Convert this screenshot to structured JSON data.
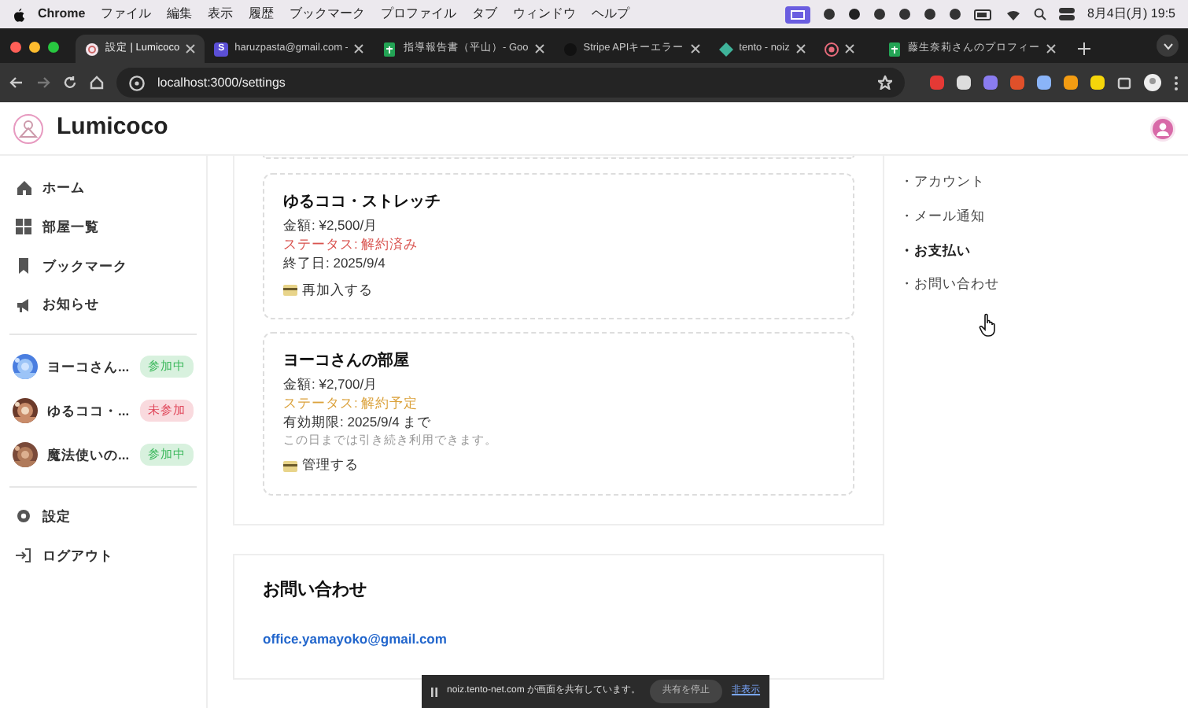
{
  "menu_bar": {
    "app": "Chrome",
    "menus": [
      "ファイル",
      "編集",
      "表示",
      "履歴",
      "ブックマーク",
      "プロファイル",
      "タブ",
      "ウィンドウ",
      "ヘルプ"
    ],
    "clock": "8月4日(月) 19:5"
  },
  "browser": {
    "tabs": [
      {
        "title": "設定 | Lumicoco",
        "selected": true,
        "kind": "logo"
      },
      {
        "title": "haruzpasta@gmail.com -",
        "selected": false,
        "kind": "letter",
        "icon_text": "S"
      },
      {
        "title": "指導報告書（平山）- Goo",
        "selected": false,
        "kind": "sheet"
      },
      {
        "title": "Stripe APIキーエラー",
        "selected": false,
        "kind": "dark"
      },
      {
        "title": "tento - noiz",
        "selected": false,
        "kind": "diamond"
      },
      {
        "selected": false,
        "kind": "target"
      },
      {
        "title": "藤生奈莉さんのプロフィー",
        "selected": false,
        "kind": "sheet"
      }
    ],
    "url": "localhost:3000/settings"
  },
  "app": {
    "brand": "Lumicoco",
    "sidebar": {
      "nav": [
        {
          "label": "ホーム",
          "kind": "home"
        },
        {
          "label": "部屋一覧",
          "kind": "grid"
        },
        {
          "label": "ブックマーク",
          "kind": "bookmark"
        },
        {
          "label": "お知らせ",
          "kind": "megaphone"
        }
      ],
      "rooms": [
        {
          "name": "ヨーコさん...",
          "badge": "参加中",
          "color": "#3cb85c"
        },
        {
          "name": "ゆるココ・...",
          "badge": "未参加",
          "color": "#e0475a"
        },
        {
          "name": "魔法使いの...",
          "badge": "参加中",
          "color": "#3cb85c"
        }
      ],
      "footer": [
        {
          "label": "設定",
          "kind": "gear"
        },
        {
          "label": "ログアウト",
          "kind": "logout"
        }
      ]
    },
    "subscriptions": [
      {
        "title": "ゆるココ・ストレッチ",
        "price": "金額: ¥2,500/月",
        "status": "ステータス: 解約済み",
        "color": "#d9534f",
        "date": "終了日: 2025/9/4",
        "action": "再加入する"
      },
      {
        "title": "ヨーコさんの部屋",
        "price": "金額: ¥2,700/月",
        "status": "ステータス: 解約予定",
        "color": "#dba23c",
        "date": "有効期限: 2025/9/4 まで",
        "note": "この日までは引き続き利用できます。",
        "action": "管理する"
      }
    ],
    "contact": {
      "heading": "お問い合わせ",
      "email": "office.yamayoko@gmail.com"
    },
    "settings_nav": [
      {
        "label": "・アカウント",
        "selected": false
      },
      {
        "label": "・メール通知",
        "selected": false
      },
      {
        "label": "・お支払い",
        "selected": true
      },
      {
        "label": "・お問い合わせ",
        "selected": false
      }
    ]
  },
  "share_bar": {
    "message": "noiz.tento-net.com が画面を共有しています。",
    "stop": "共有を停止",
    "hide": "非表示"
  }
}
